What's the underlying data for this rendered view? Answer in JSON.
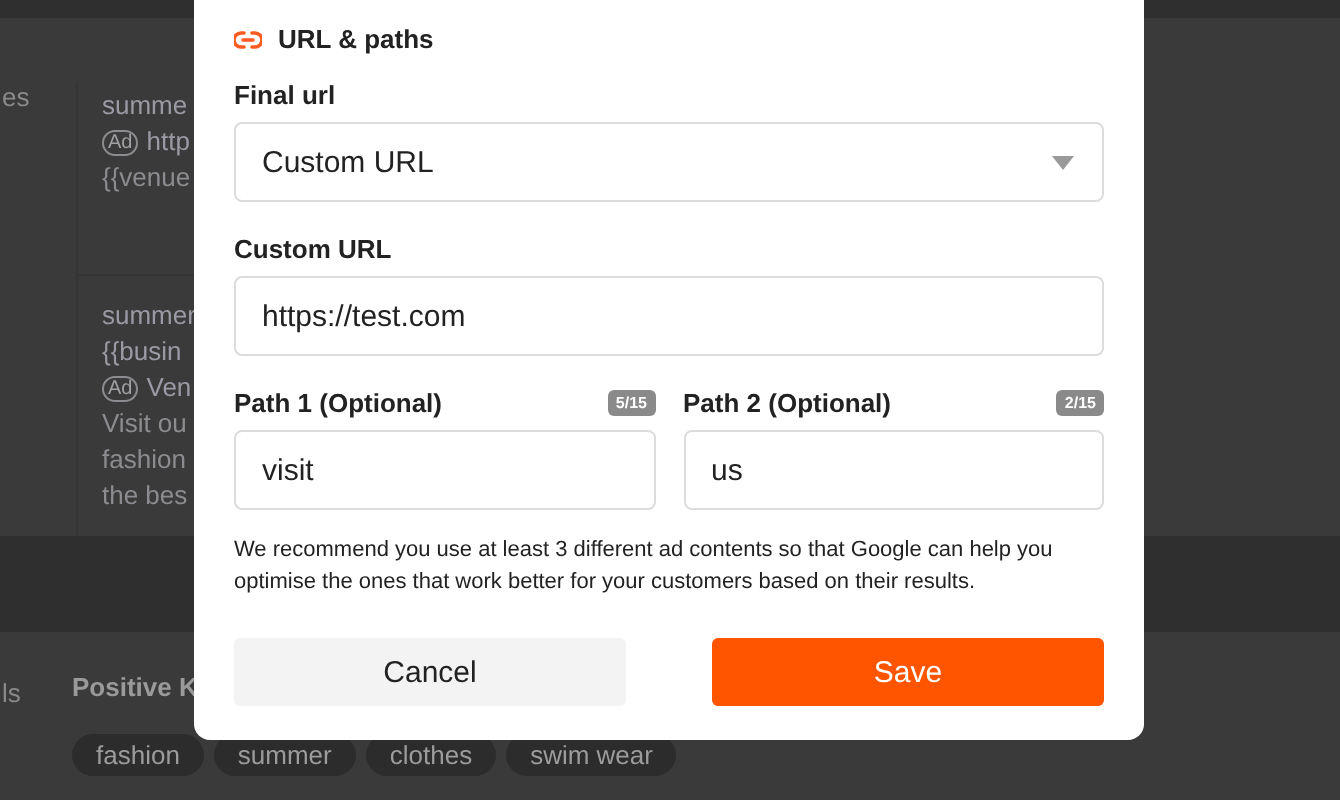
{
  "background": {
    "side_text_top": "es",
    "cards": [
      {
        "lines": [
          {
            "kind": "title",
            "text": "summe"
          },
          {
            "kind": "ad",
            "badge": "Ad",
            "text": "http"
          },
          {
            "kind": "body",
            "text": "{{venue"
          }
        ]
      },
      {
        "lines": [
          {
            "kind": "title",
            "text": "summer"
          },
          {
            "kind": "title",
            "text": "{{busin"
          },
          {
            "kind": "ad",
            "badge": "Ad",
            "text": "Ven"
          },
          {
            "kind": "body",
            "text": "Visit ou"
          },
          {
            "kind": "body",
            "text": "fashion"
          },
          {
            "kind": "body",
            "text": "the bes"
          }
        ]
      }
    ],
    "side_text_bottom": "ls",
    "keywords": {
      "title": "Positive K",
      "chips": [
        "fashion",
        "summer",
        "clothes",
        "swim wear"
      ]
    }
  },
  "dialog": {
    "section_title": "URL & paths",
    "final_url": {
      "label": "Final url",
      "value": "Custom URL"
    },
    "custom_url": {
      "label": "Custom URL",
      "value": "https://test.com"
    },
    "paths": [
      {
        "label": "Path 1 (Optional)",
        "counter": "5/15",
        "value": "visit"
      },
      {
        "label": "Path 2 (Optional)",
        "counter": "2/15",
        "value": "us"
      }
    ],
    "note": "We recommend you use at least 3 different ad contents so that Google can help you optimise the ones that work better for your customers based on their results.",
    "buttons": [
      {
        "kind": "secondary",
        "label": "Cancel"
      },
      {
        "kind": "primary",
        "label": "Save"
      }
    ]
  }
}
